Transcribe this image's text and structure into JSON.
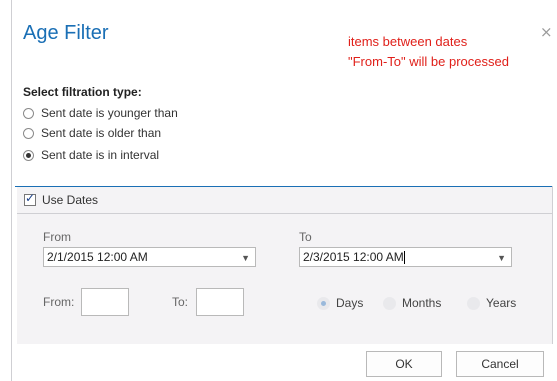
{
  "dialog": {
    "title": "Age Filter",
    "close_glyph": "×",
    "annotation_line1": "items between dates",
    "annotation_line2": "\"From-To\" will be processed"
  },
  "filtration": {
    "heading": "Select filtration type:",
    "options": [
      {
        "label": "Sent date is younger than",
        "selected": false
      },
      {
        "label": "Sent date is older than",
        "selected": false
      },
      {
        "label": "Sent date is in interval",
        "selected": true
      }
    ]
  },
  "use_dates": {
    "label": "Use Dates",
    "checked": true
  },
  "dates": {
    "from_label": "From",
    "from_value": "2/1/2015 12:00 AM",
    "to_label": "To",
    "to_value": "2/3/2015 12:00 AM"
  },
  "range": {
    "from_label": "From:",
    "to_label": "To:",
    "from_value": "",
    "to_value": "",
    "units": [
      {
        "label": "Days",
        "selected": true
      },
      {
        "label": "Months",
        "selected": false
      },
      {
        "label": "Years",
        "selected": false
      }
    ]
  },
  "buttons": {
    "ok": "OK",
    "cancel": "Cancel"
  },
  "colors": {
    "accent": "#1a6fb5",
    "annotation": "#e0201a",
    "panel": "#f4f3f5"
  }
}
